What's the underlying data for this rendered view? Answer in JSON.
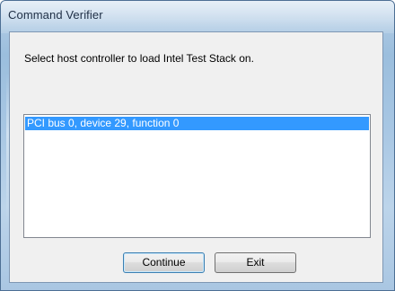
{
  "window": {
    "title": "Command Verifier"
  },
  "dialog": {
    "prompt": "Select host controller to load Intel Test Stack on.",
    "controllers": [
      {
        "label": "PCI bus 0, device 29, function 0",
        "selected": true
      }
    ],
    "buttons": {
      "continue_label": "Continue",
      "exit_label": "Exit"
    }
  },
  "colors": {
    "selection": "#3399ff",
    "selection_text": "#ffffff",
    "dialog_bg": "#f0f0f0",
    "frame": "#a9c6e2"
  }
}
